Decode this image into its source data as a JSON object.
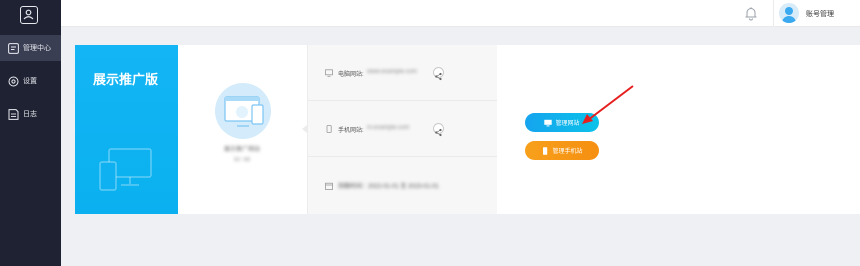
{
  "sidebar": {
    "logo_icon": "profile-card-icon",
    "items": [
      {
        "label": "管理中心",
        "icon": "dashboard-icon",
        "active": true
      },
      {
        "label": "设置",
        "icon": "settings-icon",
        "active": false
      },
      {
        "label": "日志",
        "icon": "log-icon",
        "active": false
      }
    ]
  },
  "header": {
    "notification_icon": "bell-icon",
    "account_label": "账号管理"
  },
  "site_card": {
    "badge_title": "展示推广版",
    "site_name": "展示推广网站",
    "site_id": "ID: 58",
    "rows": [
      {
        "label": "电脑网站:",
        "value": "www.example.com",
        "icon": "monitor-icon"
      },
      {
        "label": "手机网站:",
        "value": "m.example.com",
        "icon": "phone-icon"
      },
      {
        "label": "到期时间：2022-01-01 至 2023-01-01",
        "value": "",
        "icon": "calendar-icon"
      }
    ],
    "buttons": {
      "manage_pc": "管理网站",
      "manage_mobile": "管理手机站"
    }
  },
  "colors": {
    "sidebar_bg": "#1f2233",
    "brand_blue": "#0ab0ef",
    "orange": "#f7a01b",
    "annotation_red": "#e61e1e"
  }
}
